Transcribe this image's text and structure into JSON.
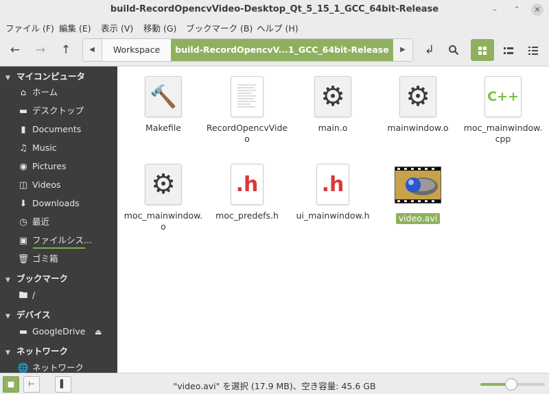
{
  "window": {
    "title": "build-RecordOpencvVideo-Desktop_Qt_5_15_1_GCC_64bit-Release"
  },
  "menubar": [
    "ファイル (F)",
    "編集 (E)",
    "表示 (V)",
    "移動 (G)",
    "ブックマーク (B)",
    "ヘルプ (H)"
  ],
  "breadcrumb": {
    "items": [
      "Workspace",
      "build-RecordOpencvV...1_GCC_64bit-Release"
    ]
  },
  "sidebar": {
    "sections": [
      {
        "title": "マイコンピュータ",
        "items": [
          {
            "label": "ホーム",
            "icon": "home-icon"
          },
          {
            "label": "デスクトップ",
            "icon": "desktop-icon"
          },
          {
            "label": "Documents",
            "icon": "documents-icon"
          },
          {
            "label": "Music",
            "icon": "music-icon"
          },
          {
            "label": "Pictures",
            "icon": "pictures-icon"
          },
          {
            "label": "Videos",
            "icon": "videos-icon"
          },
          {
            "label": "Downloads",
            "icon": "downloads-icon"
          },
          {
            "label": "最近",
            "icon": "recent-icon"
          },
          {
            "label": "ファイルシス...",
            "icon": "filesystem-icon"
          },
          {
            "label": "ゴミ箱",
            "icon": "trash-icon"
          }
        ]
      },
      {
        "title": "ブックマーク",
        "items": [
          {
            "label": "/",
            "icon": "root-folder-icon"
          }
        ]
      },
      {
        "title": "デバイス",
        "items": [
          {
            "label": "GoogleDrive",
            "icon": "drive-icon"
          }
        ]
      },
      {
        "title": "ネットワーク",
        "items": [
          {
            "label": "ネットワーク",
            "icon": "network-icon"
          }
        ]
      }
    ]
  },
  "files": [
    {
      "name": "Makefile",
      "icon": "hammer-icon"
    },
    {
      "name": "RecordOpencvVideo",
      "icon": "document-icon"
    },
    {
      "name": "main.o",
      "icon": "gear-icon"
    },
    {
      "name": "mainwindow.o",
      "icon": "gear-icon"
    },
    {
      "name": "moc_mainwindow.cpp",
      "icon": "cpp-icon",
      "glyph": "C++"
    },
    {
      "name": "moc_mainwindow.o",
      "icon": "gear-icon"
    },
    {
      "name": "moc_predefs.h",
      "icon": "header-icon",
      "glyph": ".h"
    },
    {
      "name": "ui_mainwindow.h",
      "icon": "header-icon",
      "glyph": ".h"
    },
    {
      "name": "video.avi",
      "icon": "video-thumbnail",
      "selected": true
    }
  ],
  "status": {
    "text": "\"video.avi\" を選択 (17.9 MB)、空き容量: 45.6 GB"
  },
  "zoom": {
    "level": 0.47
  },
  "colors": {
    "accent": "#8fb15f",
    "sidebar_bg": "#3d3d3d",
    "header_red": "#d63a3a",
    "cpp_green": "#7bc043"
  }
}
